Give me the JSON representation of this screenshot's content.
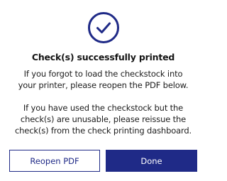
{
  "dialog": {
    "icon": "check-circle-icon",
    "accent_color": "#1f2a87",
    "title": "Check(s) successfully printed",
    "paragraph_1": [
      "If you forgot to load the checkstock into",
      "your printer, please reopen the PDF below."
    ],
    "paragraph_2": [
      "If you have used the checkstock but the",
      "check(s) are unusable, please reissue the",
      "check(s) from the check printing dashboard."
    ],
    "reopen_label": "Reopen PDF",
    "done_label": "Done"
  }
}
